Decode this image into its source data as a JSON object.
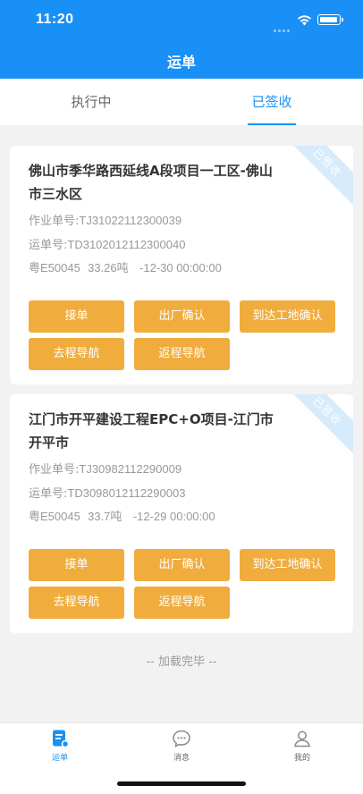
{
  "status": {
    "time": "11:20"
  },
  "nav": {
    "title": "运单"
  },
  "tabs": [
    {
      "label": "执行中",
      "active": false
    },
    {
      "label": "已签收",
      "active": true
    }
  ],
  "cards": [
    {
      "title": "佛山市季华路西延线A段项目一工区-佛山市三水区",
      "ribbon": "已签收",
      "work_no_label": "作业单号:",
      "work_no": "TJ31022112300039",
      "waybill_no_label": "运单号:",
      "waybill_no": "TD3102012112300040",
      "plate": "粤E50045",
      "weight": "33.26吨",
      "datetime": "-12-30 00:00:00",
      "buttons": [
        "接单",
        "出厂确认",
        "到达工地确认",
        "去程导航",
        "返程导航"
      ]
    },
    {
      "title": "江门市开平建设工程EPC+O项目-江门市开平市",
      "ribbon": "已签收",
      "work_no_label": "作业单号:",
      "work_no": "TJ30982112290009",
      "waybill_no_label": "运单号:",
      "waybill_no": "TD3098012112290003",
      "plate": "粤E50045",
      "weight": "33.7吨",
      "datetime": "-12-29 00:00:00",
      "buttons": [
        "接单",
        "出厂确认",
        "到达工地确认",
        "去程导航",
        "返程导航"
      ]
    }
  ],
  "load_done": "-- 加载完毕 --",
  "tabbar": [
    {
      "label": "运单",
      "icon": "waybill-icon",
      "active": true
    },
    {
      "label": "消息",
      "icon": "message-icon",
      "active": false
    },
    {
      "label": "我的",
      "icon": "profile-icon",
      "active": false
    }
  ],
  "colors": {
    "primary": "#1890f5",
    "button": "#f0ad3e",
    "ribbon": "#d6ebfb"
  }
}
